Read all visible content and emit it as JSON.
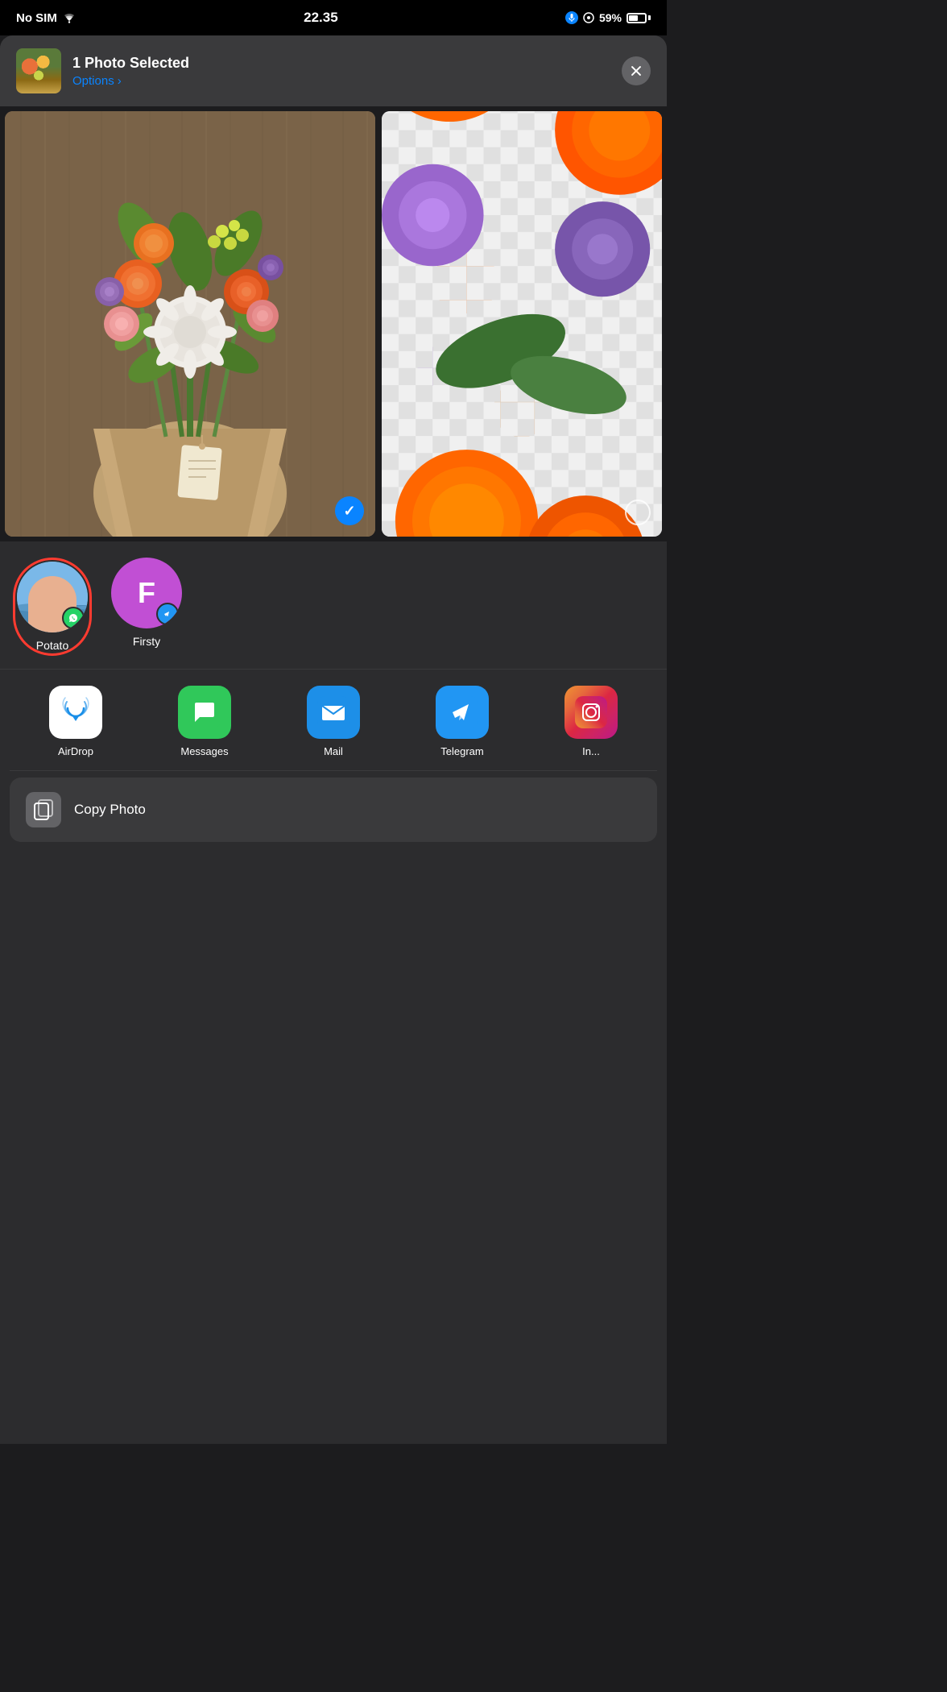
{
  "status_bar": {
    "carrier": "No SIM",
    "time": "22.35",
    "battery": "59%"
  },
  "share_header": {
    "title": "1 Photo Selected",
    "options_label": "Options",
    "options_chevron": "›",
    "close_label": "×"
  },
  "contacts": [
    {
      "name": "Potato",
      "id": "potato",
      "selected": true
    },
    {
      "name": "Firsty",
      "id": "firsty",
      "initial": "F",
      "selected": false
    }
  ],
  "apps": [
    {
      "id": "airdrop",
      "name": "AirDrop"
    },
    {
      "id": "messages",
      "name": "Messages"
    },
    {
      "id": "mail",
      "name": "Mail"
    },
    {
      "id": "telegram",
      "name": "Telegram"
    },
    {
      "id": "instagram",
      "name": "In..."
    }
  ],
  "actions": [
    {
      "id": "copy-photo",
      "label": "Copy Photo"
    }
  ],
  "colors": {
    "accent": "#0a84ff",
    "selected_border": "#ff3b30",
    "background": "#2c2c2e",
    "card": "#3a3a3c"
  }
}
